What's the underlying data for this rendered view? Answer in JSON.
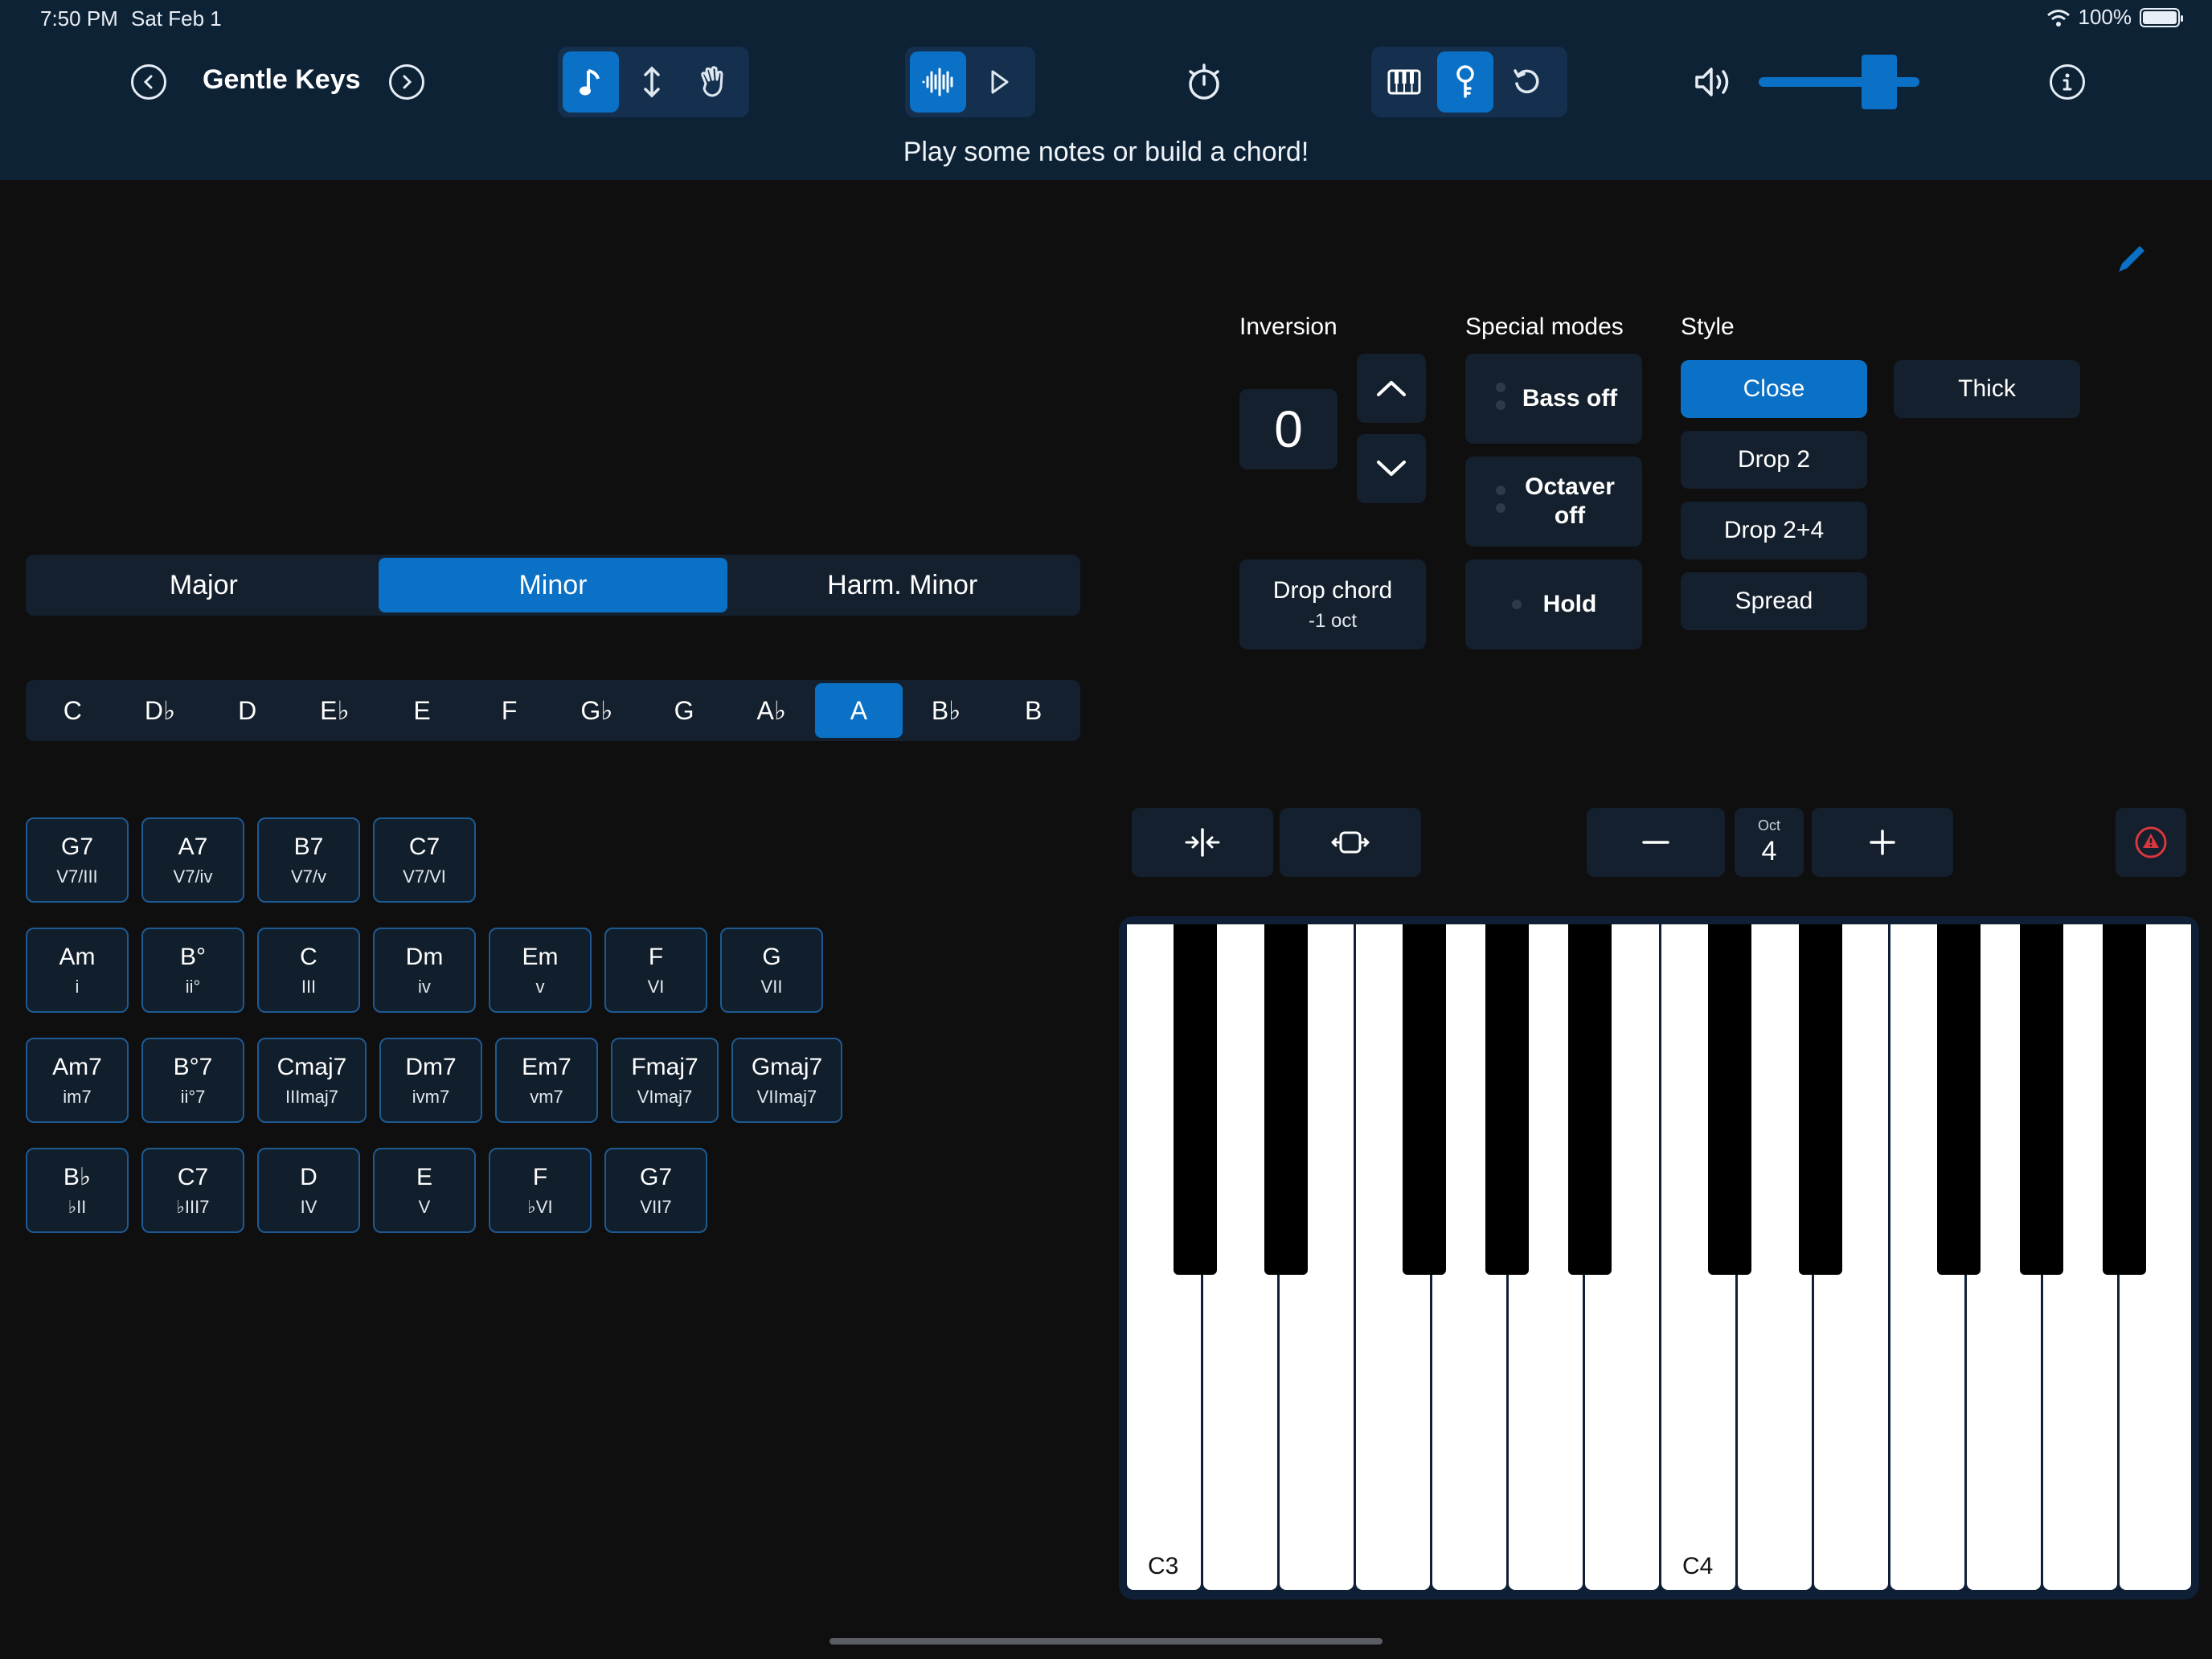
{
  "status": {
    "time": "7:50 PM",
    "date": "Sat Feb 1",
    "battery": "100%"
  },
  "header": {
    "preset_title": "Gentle Keys",
    "hint": "Play some notes or build a chord!",
    "volume_level": 0.75,
    "icons": {
      "prev": "chevron-left-circle",
      "next": "chevron-right-circle",
      "note": "music-note",
      "updown": "arrows-up-down",
      "hand": "hand-wave",
      "waveform": "waveform",
      "play": "play",
      "metronome": "timer",
      "piano": "piano-keys",
      "key": "key-lock",
      "reset": "rotate-left",
      "volume": "speaker",
      "info": "info-circle"
    }
  },
  "scale_modes": [
    {
      "label": "Major",
      "active": false
    },
    {
      "label": "Minor",
      "active": true
    },
    {
      "label": "Harm. Minor",
      "active": false
    }
  ],
  "keys": [
    {
      "label": "C",
      "active": false
    },
    {
      "label": "D♭",
      "active": false
    },
    {
      "label": "D",
      "active": false
    },
    {
      "label": "E♭",
      "active": false
    },
    {
      "label": "E",
      "active": false
    },
    {
      "label": "F",
      "active": false
    },
    {
      "label": "G♭",
      "active": false
    },
    {
      "label": "G",
      "active": false
    },
    {
      "label": "A♭",
      "active": false
    },
    {
      "label": "A",
      "active": true
    },
    {
      "label": "B♭",
      "active": false
    },
    {
      "label": "B",
      "active": false
    }
  ],
  "chord_rows": [
    [
      {
        "name": "G7",
        "func": "V7/III"
      },
      {
        "name": "A7",
        "func": "V7/iv"
      },
      {
        "name": "B7",
        "func": "V7/v"
      },
      {
        "name": "C7",
        "func": "V7/VI"
      }
    ],
    [
      {
        "name": "Am",
        "func": "i"
      },
      {
        "name": "B°",
        "func": "ii°"
      },
      {
        "name": "C",
        "func": "III"
      },
      {
        "name": "Dm",
        "func": "iv"
      },
      {
        "name": "Em",
        "func": "v"
      },
      {
        "name": "F",
        "func": "VI"
      },
      {
        "name": "G",
        "func": "VII"
      }
    ],
    [
      {
        "name": "Am7",
        "func": "im7"
      },
      {
        "name": "B°7",
        "func": "ii°7"
      },
      {
        "name": "Cmaj7",
        "func": "IIImaj7"
      },
      {
        "name": "Dm7",
        "func": "ivm7"
      },
      {
        "name": "Em7",
        "func": "vm7"
      },
      {
        "name": "Fmaj7",
        "func": "VImaj7"
      },
      {
        "name": "Gmaj7",
        "func": "VIImaj7"
      }
    ],
    [
      {
        "name": "B♭",
        "func": "♭II"
      },
      {
        "name": "C7",
        "func": "♭III7"
      },
      {
        "name": "D",
        "func": "IV"
      },
      {
        "name": "E",
        "func": "V"
      },
      {
        "name": "F",
        "func": "♭VI"
      },
      {
        "name": "G7",
        "func": "VII7"
      }
    ]
  ],
  "inversion": {
    "label": "Inversion",
    "value": "0"
  },
  "drop_chord": {
    "label": "Drop chord",
    "sub": "-1 oct"
  },
  "special_modes": {
    "label": "Special modes",
    "bass": "Bass off",
    "octaver": "Octaver off",
    "hold": "Hold"
  },
  "style": {
    "label": "Style",
    "options": [
      {
        "label": "Close",
        "active": true
      },
      {
        "label": "Thick",
        "active": false
      },
      {
        "label": "Drop 2",
        "active": false
      },
      {
        "label": "Drop 2+4",
        "active": false
      },
      {
        "label": "Spread",
        "active": false
      }
    ]
  },
  "octave": {
    "label": "Oct",
    "value": "4"
  },
  "keyboard": {
    "labels": [
      "C3",
      "C4"
    ]
  }
}
